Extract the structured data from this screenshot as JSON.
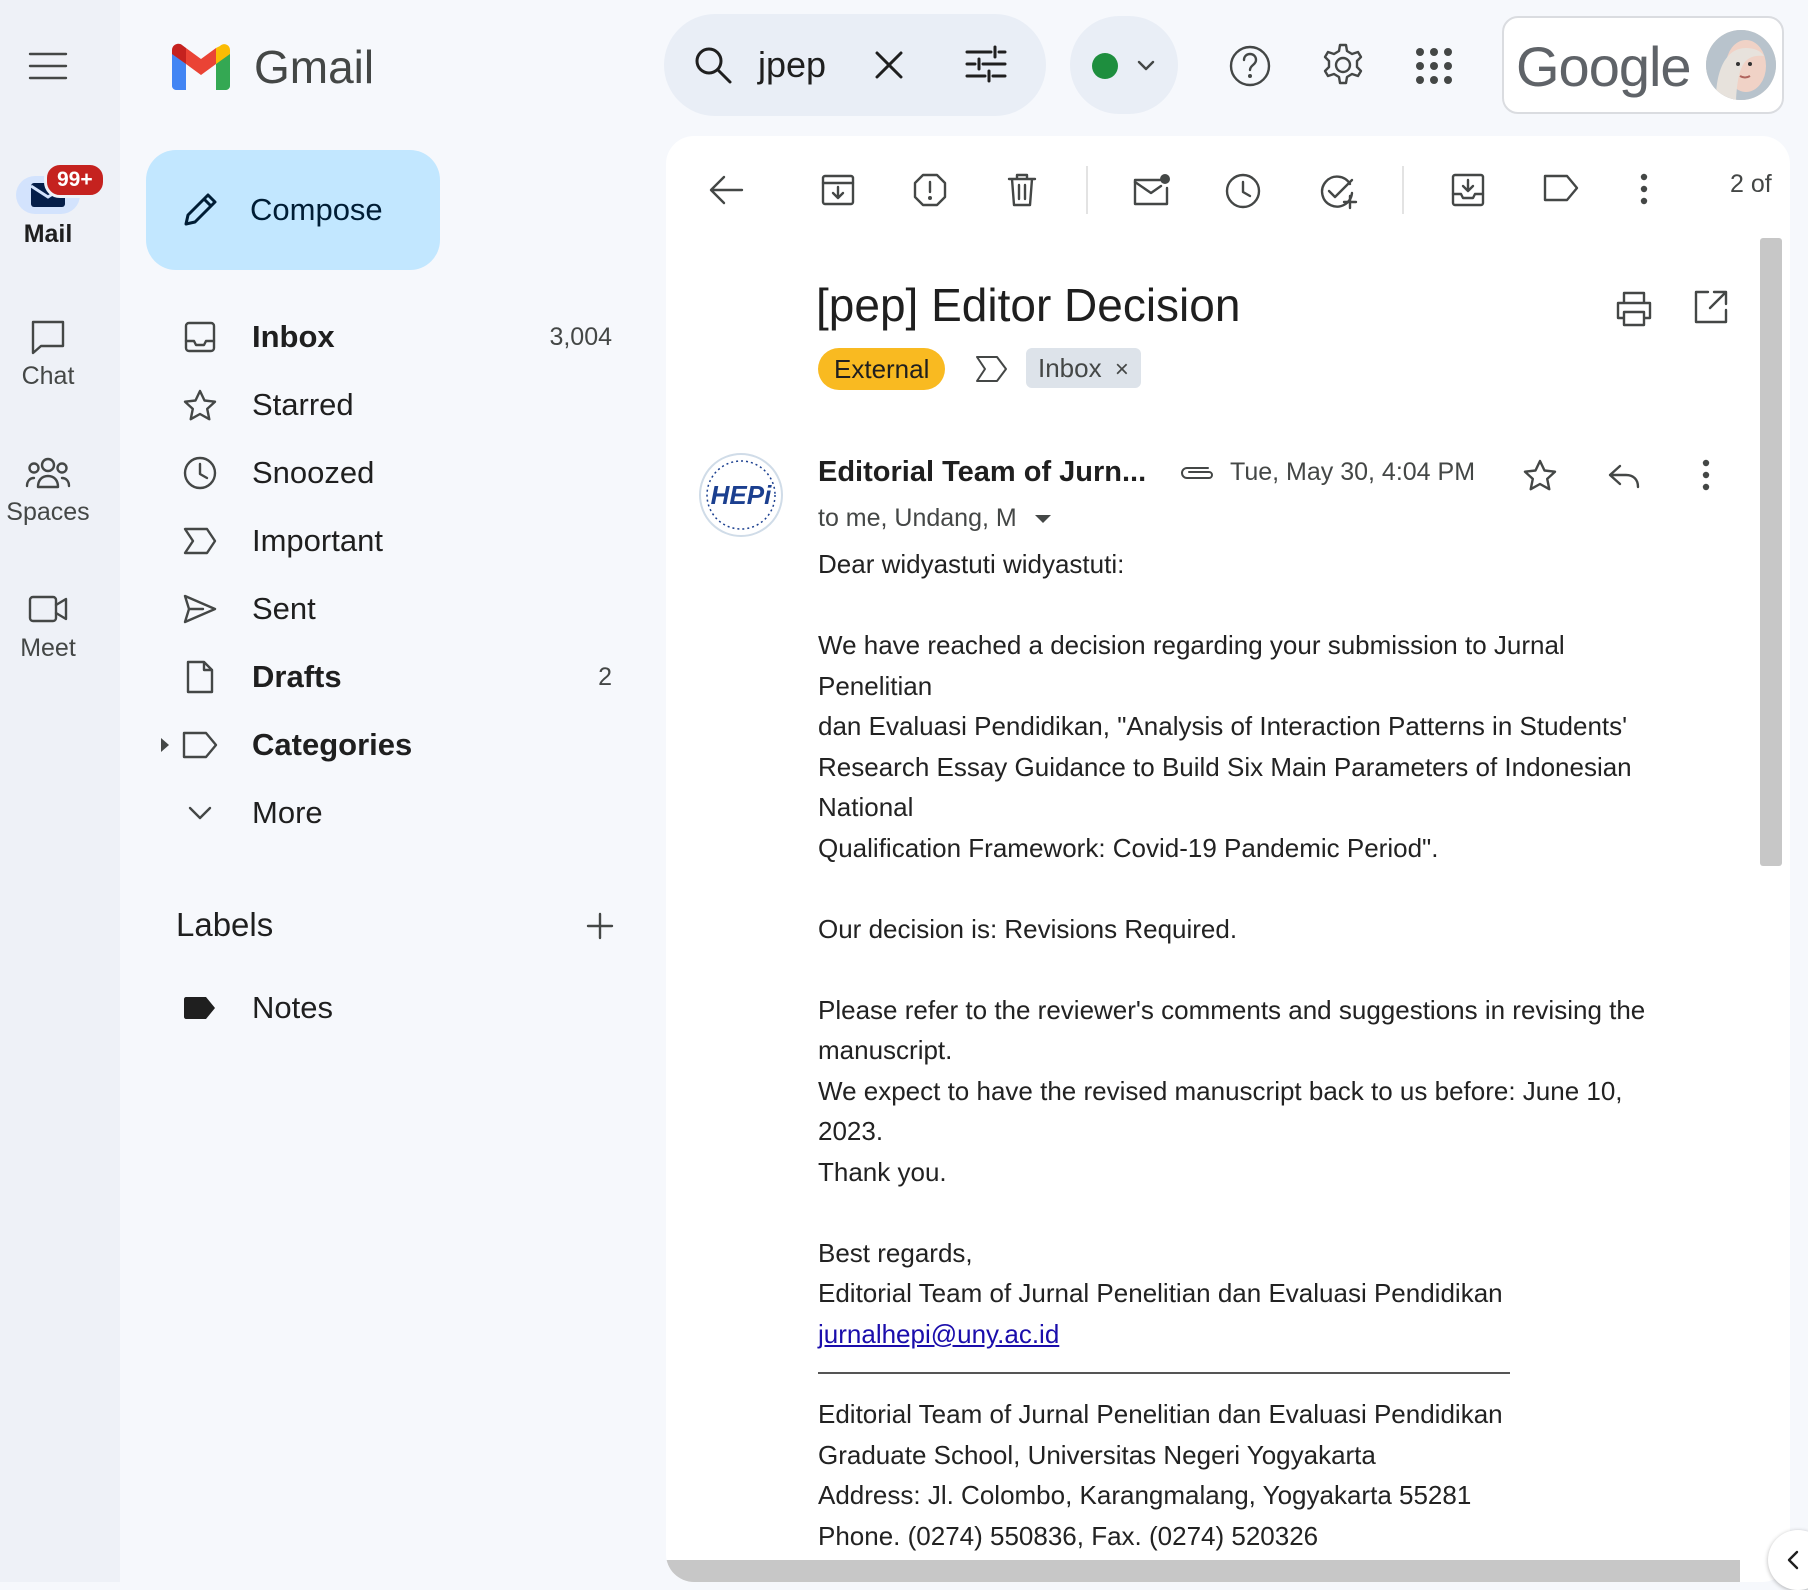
{
  "app": {
    "name": "Gmail"
  },
  "rail": {
    "mail_label": "Mail",
    "mail_badge": "99+",
    "chat_label": "Chat",
    "spaces_label": "Spaces",
    "meet_label": "Meet"
  },
  "sidebar": {
    "compose_label": "Compose",
    "items": [
      {
        "label": "Inbox",
        "count": "3,004"
      },
      {
        "label": "Starred",
        "count": ""
      },
      {
        "label": "Snoozed",
        "count": ""
      },
      {
        "label": "Important",
        "count": ""
      },
      {
        "label": "Sent",
        "count": ""
      },
      {
        "label": "Drafts",
        "count": "2"
      },
      {
        "label": "Categories",
        "count": ""
      },
      {
        "label": "More",
        "count": ""
      }
    ],
    "labels_heading": "Labels",
    "labels": [
      {
        "label": "Notes"
      }
    ]
  },
  "search": {
    "value": "jpep"
  },
  "status": {
    "color": "#1e8e3e"
  },
  "account": {
    "google_word": "Google"
  },
  "toolbar": {
    "pagination": "2 of"
  },
  "message": {
    "subject": "[pep] Editor Decision",
    "chip_external": "External",
    "chip_inbox": "Inbox",
    "chip_inbox_close": "×",
    "sender": "Editorial Team of Jurn...",
    "datetime": "Tue, May 30, 4:04 PM",
    "recipients": "to me, Undang, M",
    "avatar_text": "HEPi",
    "body": {
      "greeting": "Dear widyastuti widyastuti:",
      "para1": "We have reached a decision regarding your submission to Jurnal\nPenelitian\ndan Evaluasi Pendidikan, \"Analysis of Interaction Patterns in Students'\nResearch Essay Guidance to Build Six Main Parameters of Indonesian\nNational\nQualification Framework: Covid-19 Pandemic Period\".",
      "decision": "Our decision is: Revisions Required.",
      "para2": "Please refer to the reviewer's comments and suggestions in revising the\nmanuscript.\nWe expect to have the revised manuscript back to us before: June 10,\n2023.\nThank you.",
      "regards": "Best regards,",
      "sign_team": "Editorial Team of Jurnal Penelitian dan Evaluasi Pendidikan",
      "email": "jurnalhepi@uny.ac.id",
      "footer1": "Editorial Team of Jurnal Penelitian dan Evaluasi Pendidikan",
      "footer2": "Graduate School, Universitas Negeri Yogyakarta",
      "footer3": "Address: Jl. Colombo, Karangmalang, Yogyakarta 55281",
      "footer4": "Phone. (0274) 550836, Fax. (0274) 520326"
    }
  }
}
